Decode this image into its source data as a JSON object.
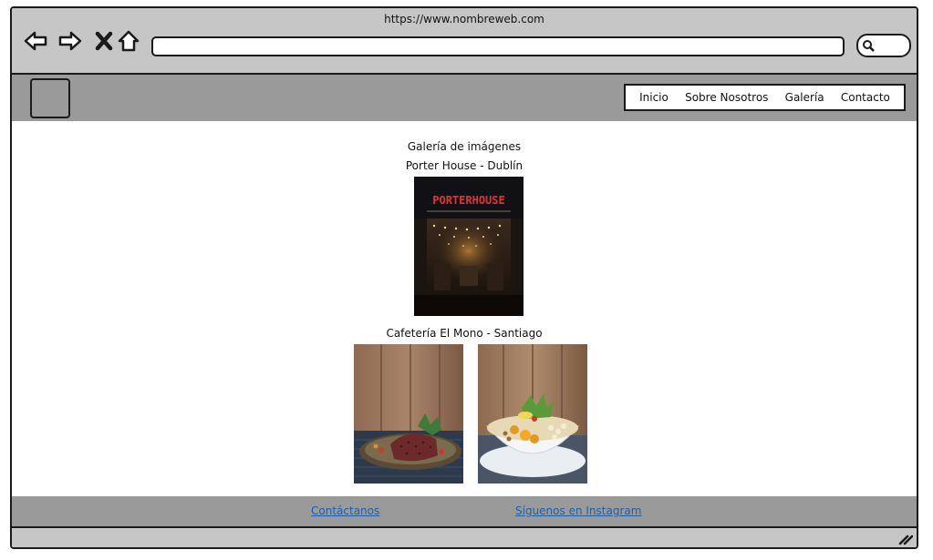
{
  "browser": {
    "url": "https://www.nombreweb.com",
    "icons": [
      "back-arrow-icon",
      "forward-arrow-icon",
      "close-icon",
      "home-icon",
      "search-icon"
    ]
  },
  "nav": {
    "items": [
      "Inicio",
      "Sobre Nosotros",
      "Galería",
      "Contacto"
    ]
  },
  "gallery": {
    "title": "Galería de imágenes",
    "sections": [
      {
        "caption": "Porter House - Dublín",
        "sign_text": "PORTERHOUSE"
      },
      {
        "caption": "Cafetería El Mono - Santiago"
      }
    ]
  },
  "footer": {
    "links": [
      "Contáctanos",
      "Síguenos en Instagram"
    ],
    "link_color": "#1f5fa8"
  },
  "colors": {
    "chrome": "#c6c6c6",
    "header": "#9a9a9a",
    "sign": "#e8322a"
  }
}
